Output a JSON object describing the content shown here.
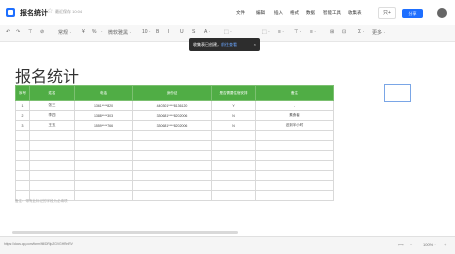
{
  "header": {
    "doc_title": "报名统计",
    "save_status": "最近保存 10:04",
    "menu": [
      "文件",
      "编辑",
      "插入",
      "格式",
      "数据",
      "智能工具",
      "收集表"
    ],
    "collab_label": "只+",
    "share_label": "分享"
  },
  "toolbar": {
    "items": [
      "↶",
      "↷",
      "⊤",
      "⊘",
      "常规 ·",
      "¥",
      "%",
      "·",
      "微软雅黑 ·",
      "10 ·",
      "B",
      "I",
      "U",
      "S",
      "A ·",
      "⬚ ·",
      "⬚ ·",
      "≡ ·",
      "⊤ ·",
      "≡ ·",
      "⊞",
      "⊡",
      "Σ ·",
      "更多 ·"
    ]
  },
  "toast": {
    "text": "收集表已创建，",
    "link": "前往查看",
    "close": "×"
  },
  "sheet": {
    "title": "报名统计",
    "headers": [
      "序号",
      "姓名",
      "电话",
      "身份证",
      "是否需要住宿安排",
      "备注"
    ],
    "rows": [
      [
        "1",
        "张三",
        "1361****820",
        "440301****8136120",
        "Y",
        "-"
      ],
      [
        "2",
        "李四",
        "1388****303",
        "330681****8202006",
        "N",
        "素食者"
      ],
      [
        "3",
        "王五",
        "1559****766",
        "330681****8202006",
        "N",
        "迟到半小时"
      ],
      [
        "",
        "",
        "",
        "",
        "",
        ""
      ],
      [
        "",
        "",
        "",
        "",
        "",
        ""
      ],
      [
        "",
        "",
        "",
        "",
        "",
        ""
      ],
      [
        "",
        "",
        "",
        "",
        "",
        ""
      ],
      [
        "",
        "",
        "",
        "",
        "",
        ""
      ],
      [
        "",
        "",
        "",
        "",
        "",
        ""
      ],
      [
        "",
        "",
        "",
        "",
        "",
        ""
      ]
    ],
    "note": "备注：带有此标记的字段为必填项"
  },
  "footer": {
    "url": "https://docs.qq.com/form/fill/DRlpZGVGHRnRV",
    "zoom": "100% ·",
    "buttons": [
      "⟷",
      "−",
      "+"
    ]
  },
  "colors": {
    "header_green": "#50ad45",
    "accent_blue": "#1e6fff"
  }
}
